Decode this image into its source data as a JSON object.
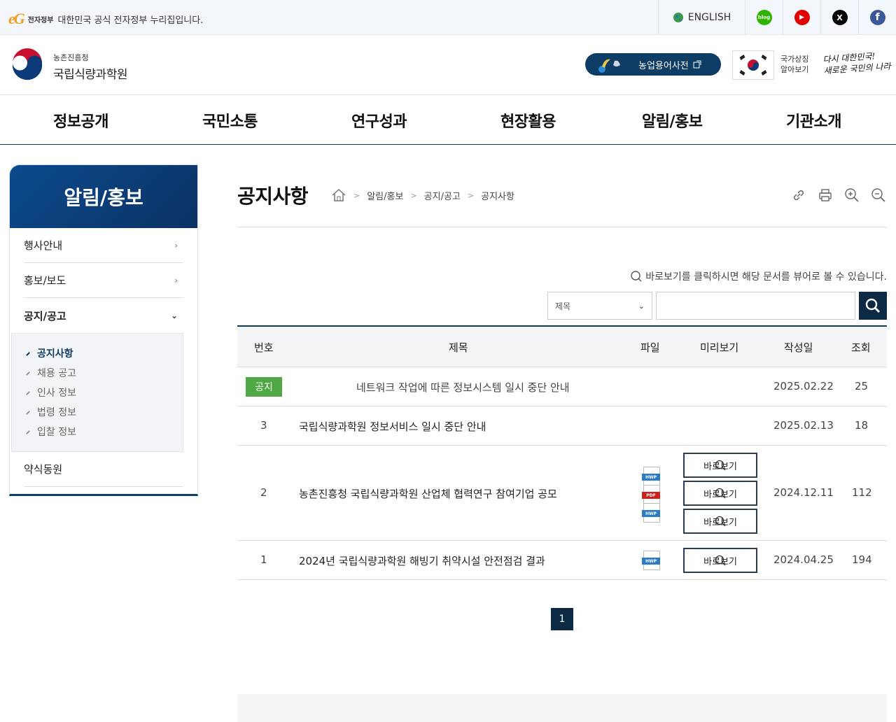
{
  "topbar": {
    "eg_mark": "eG",
    "eg_small": "전자정부",
    "gov_text": "대한민국 공식 전자정부 누리집입니다.",
    "english": "ENGLISH",
    "sns": [
      {
        "name": "blog",
        "glyph": "blog",
        "color": "#2db400"
      },
      {
        "name": "youtube",
        "glyph": "▶",
        "color": "#e00000"
      },
      {
        "name": "x",
        "glyph": "X",
        "color": "#000000"
      },
      {
        "name": "facebook",
        "glyph": "f",
        "color": "#3b5998"
      }
    ]
  },
  "header": {
    "org_small": "농촌진흥청",
    "org_name": "국립식량과학원",
    "dict_label": "농업용어사전",
    "flag_text_1": "국가상징",
    "flag_text_2": "알아보기",
    "slogan_1": "다시 대한민국!",
    "slogan_2": "새로운 국민의 나라"
  },
  "gnb": [
    "정보공개",
    "국민소통",
    "연구성과",
    "현장활용",
    "알림/홍보",
    "기관소개"
  ],
  "lnb": {
    "title": "알림/홍보",
    "items": [
      "행사안내",
      "홍보/보도",
      "공지/공고",
      "약식동원"
    ],
    "sub": [
      "공지사항",
      "채용 공고",
      "인사 정보",
      "법령 정보",
      "입찰 정보"
    ]
  },
  "page": {
    "title": "공지사항",
    "breadcrumb": [
      "알림/홍보",
      "공지/공고",
      "공지사항"
    ],
    "notice": "바로보기를 클릭하시면 해당 문서를 뷰어로 볼 수 있습니다.",
    "search_select": "제목",
    "page_number": "1"
  },
  "table": {
    "headers": [
      "번호",
      "제목",
      "파일",
      "미리보기",
      "작성일",
      "조회"
    ],
    "badge": "공지",
    "preview_label": "바로보기",
    "rows": [
      {
        "num": "",
        "title": "네트워크 작업에 따른 정보시스템 일시 중단 안내",
        "date": "2025.02.22",
        "hits": "25"
      },
      {
        "num": "3",
        "title": "국립식량과학원 정보서비스 일시 중단 안내",
        "date": "2025.02.13",
        "hits": "18"
      },
      {
        "num": "2",
        "title": "농촌진흥청 국립식량과학원 산업체 협력연구 참여기업 공모",
        "date": "2024.12.11",
        "hits": "112"
      },
      {
        "num": "1",
        "title": "2024년 국립식량과학원 해빙기 취약시설 안전점검 결과",
        "date": "2024.04.25",
        "hits": "194"
      }
    ],
    "file_labels": [
      "HWP",
      "PDF",
      "HWP",
      "HWP"
    ]
  },
  "colors": {
    "primary": "#0d3c64",
    "badge": "#4fa843"
  }
}
